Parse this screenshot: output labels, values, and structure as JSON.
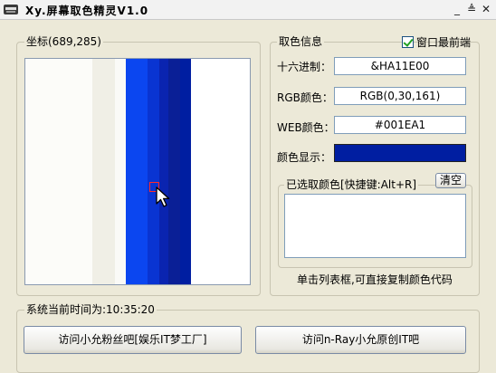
{
  "window": {
    "title": "Xy.屏幕取色精灵V1.0",
    "buttons": {
      "minimize": "_",
      "restore": "≜",
      "close": "✕"
    }
  },
  "preview": {
    "legend": "坐标(689,285)",
    "strip_colors": [
      "#fcfcf9",
      "#f0efe6",
      "#fafaf7",
      "#0b46f0",
      "#0934d2",
      "#0a24b0",
      "#0a1f96",
      "#001ea1",
      "#ffffff"
    ]
  },
  "color_info": {
    "legend": "取色信息",
    "always_on_top_label": "窗口最前端",
    "always_on_top_checked": true,
    "hex_label": "十六进制：",
    "hex_value": "&HA11E00",
    "rgb_label": "RGB颜色：",
    "rgb_value": "RGB(0,30,161)",
    "web_label": "WEB颜色：",
    "web_value": "#001EA1",
    "display_label": "颜色显示：",
    "display_color": "#001EA1"
  },
  "selected": {
    "legend": "已选取颜色[快捷键:Alt+R]",
    "clear_button": "清空",
    "items": [],
    "hint": "单击列表框,可直接复制颜色代码"
  },
  "footer": {
    "time_legend": "系统当前时间为:10:35:20",
    "link1": "访问小允粉丝吧[娱乐IT梦工厂]",
    "link2": "访问n-Ray小允原创IT吧"
  }
}
